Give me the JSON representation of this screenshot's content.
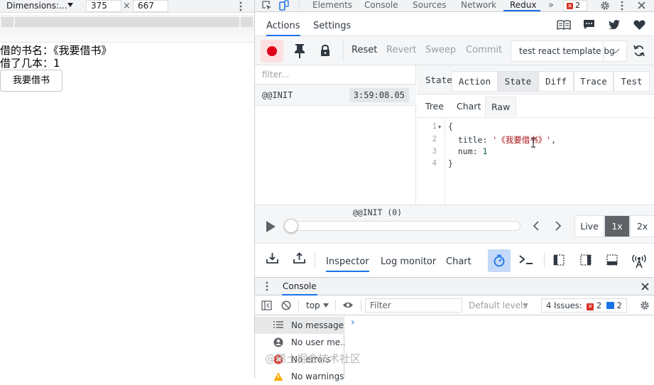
{
  "device_toolbar": {
    "dimensions_label": "Dimensions:...",
    "width": "375",
    "height": "667",
    "times": "×"
  },
  "app": {
    "book_line": "借的书名：《我要借书》",
    "count_line": "借了几本：1",
    "borrow_button": "我要借书"
  },
  "devtools": {
    "tabs": [
      "Elements",
      "Console",
      "Sources",
      "Network",
      "Redux"
    ],
    "more": "»",
    "error_count": "2"
  },
  "redux": {
    "tabs": [
      "Actions",
      "Settings"
    ],
    "toolbar": {
      "reset": "Reset",
      "revert": "Revert",
      "sweep": "Sweep",
      "commit": "Commit",
      "instance": "test react template bg"
    },
    "filter_placeholder": "filter...",
    "actions": [
      {
        "name": "@@INIT",
        "time": "3:59:08.05"
      }
    ],
    "state_label": "State",
    "view_tabs": [
      "Action",
      "State",
      "Diff",
      "Trace",
      "Test"
    ],
    "sub_tabs": [
      "Tree",
      "Chart",
      "Raw"
    ],
    "raw": {
      "line_numbers": [
        "1",
        "2",
        "3",
        "4"
      ],
      "open": "{",
      "title_key": "  title: ",
      "title_value": "'《我要借书》'",
      "title_comma": ",",
      "num_key": "  num: ",
      "num_value": "1",
      "close": "}"
    },
    "slider": {
      "label": "@@INIT (0)",
      "position": 0
    },
    "speeds": [
      "Live",
      "1x",
      "2x"
    ],
    "monitors": [
      "Inspector",
      "Log monitor",
      "Chart"
    ]
  },
  "console": {
    "title": "Console",
    "context": "top",
    "filter_placeholder": "Filter",
    "levels": "Default levels",
    "issues_label": "4 Issues:",
    "issues_errors": "2",
    "issues_info": "2",
    "prompt": "›",
    "sidebar": [
      "No messages",
      "No user me...",
      "No errors",
      "No warnings"
    ]
  },
  "watermark": "@稀土掘金技术社区"
}
